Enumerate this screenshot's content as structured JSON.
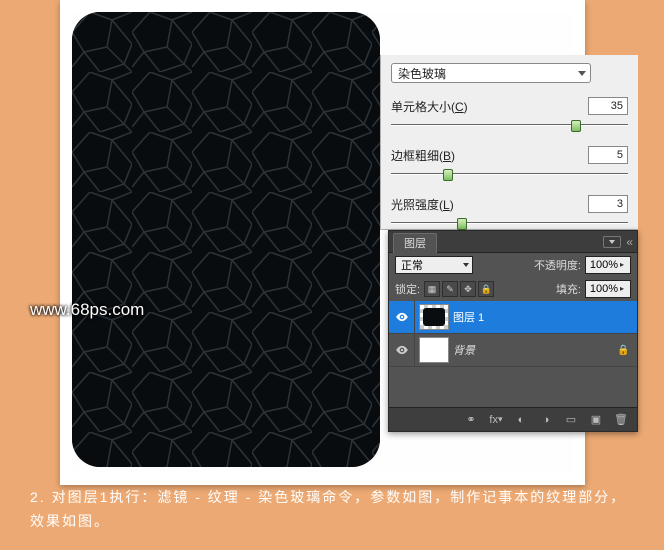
{
  "watermark": "www.68ps.com",
  "filter_panel": {
    "dropdown_label": "染色玻璃",
    "controls": [
      {
        "label_pre": "单元格大小(",
        "hot": "C",
        "label_post": ")",
        "value": "35",
        "pos": 78
      },
      {
        "label_pre": "边框粗细(",
        "hot": "B",
        "label_post": ")",
        "value": "5",
        "pos": 24
      },
      {
        "label_pre": "光照强度(",
        "hot": "L",
        "label_post": ")",
        "value": "3",
        "pos": 30
      }
    ]
  },
  "layers_panel": {
    "tab": "图层",
    "blend_mode": "正常",
    "opacity_label": "不透明度:",
    "opacity_value": "100%",
    "lock_label": "锁定:",
    "fill_label": "填充:",
    "fill_value": "100%",
    "layers": [
      {
        "name": "图层 1",
        "selected": true,
        "thumb": "tx",
        "locked": false
      },
      {
        "name": "背景",
        "selected": false,
        "thumb": "bg",
        "locked": true
      }
    ]
  },
  "caption": "2. 对图层1执行：滤镜 - 纹理 - 染色玻璃命令，参数如图，制作记事本的纹理部分，效果如图。",
  "chart_data": {
    "type": "table",
    "note": "UI panel; no chart data"
  }
}
